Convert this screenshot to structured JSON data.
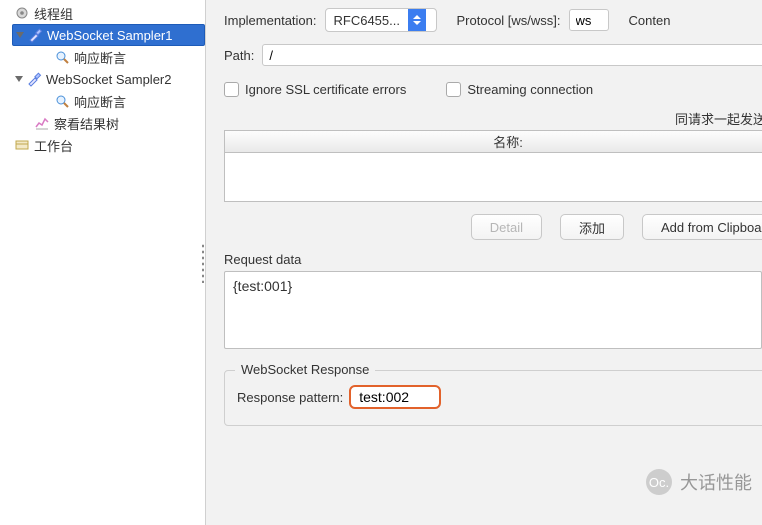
{
  "tree": {
    "thread_group": "线程组",
    "sampler1": "WebSocket Sampler1",
    "assert1": "响应断言",
    "sampler2": "WebSocket Sampler2",
    "assert2": "响应断言",
    "view_tree": "察看结果树",
    "workbench": "工作台"
  },
  "form": {
    "implementation_label": "Implementation:",
    "implementation_value": "RFC6455...",
    "protocol_label": "Protocol [ws/wss]:",
    "protocol_value": "ws",
    "content_label_cut": "Conten",
    "path_label": "Path:",
    "path_value": "/",
    "ignore_ssl_label": "Ignore SSL certificate errors",
    "streaming_label": "Streaming connection",
    "send_params_note": "同请求一起发送参数",
    "table_header": "名称:",
    "btn_detail": "Detail",
    "btn_add": "添加",
    "btn_clipboard": "Add from Clipboard",
    "request_data_label": "Request data",
    "request_data_value": "{test:001}",
    "ws_response_legend": "WebSocket Response",
    "response_pattern_label": "Response pattern:",
    "response_pattern_value": "test:002"
  },
  "watermark": {
    "icon_text": "Oc.",
    "text": "大话性能"
  }
}
